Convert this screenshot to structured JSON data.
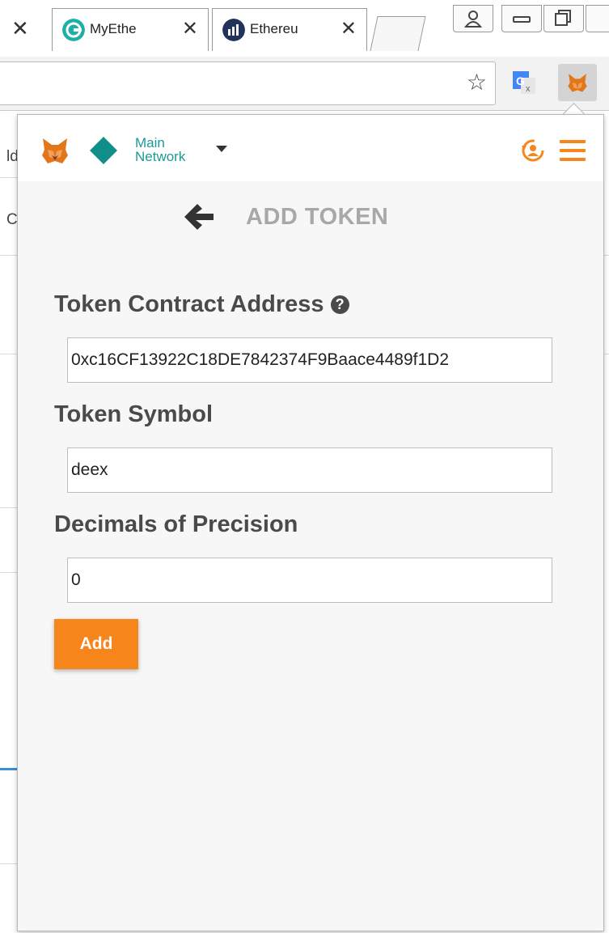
{
  "browser": {
    "tabs": [
      {
        "title": "MyEthe",
        "favicon": "myetherwallet-icon"
      },
      {
        "title": "Ethereu",
        "favicon": "etherscan-icon"
      }
    ],
    "close_glyph": "✕",
    "star_glyph": "☆"
  },
  "background_page": {
    "fragments": [
      "ld",
      "C"
    ]
  },
  "metamask": {
    "network": {
      "line1": "Main",
      "line2": "Network"
    },
    "page_title": "ADD TOKEN",
    "fields": {
      "contract_address": {
        "label": "Token Contract Address",
        "value": "0xc16CF13922C18DE7842374F9Baace4489f1D2"
      },
      "symbol": {
        "label": "Token Symbol",
        "value": "deex"
      },
      "decimals": {
        "label": "Decimals of Precision",
        "value": "0"
      }
    },
    "help_glyph": "?",
    "add_button": "Add",
    "colors": {
      "accent": "#f6851b",
      "network": "#0f8e8a",
      "title": "#a8a8a8",
      "label": "#4a4a4a"
    }
  }
}
